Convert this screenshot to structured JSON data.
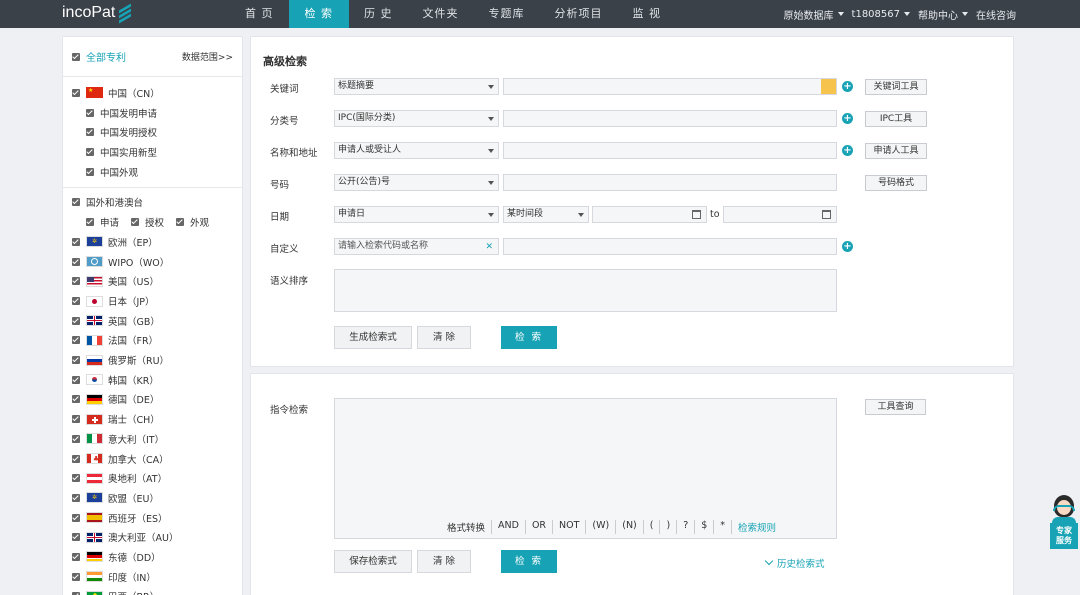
{
  "brand": {
    "logo_text": "incoPat"
  },
  "nav": {
    "items": [
      "首 页",
      "检 索",
      "历 史",
      "文件夹",
      "专题库",
      "分析项目",
      "监 视"
    ],
    "active_index": 1
  },
  "topright": {
    "database": "原始数据库",
    "user": "t1808567",
    "help": "帮助中心",
    "consult": "在线咨询"
  },
  "sidebar": {
    "all_label": "全部专利",
    "range_label": "数据范围>>",
    "cn_label": "中国（CN）",
    "cn_sub": [
      "中国发明申请",
      "中国发明授权",
      "中国实用新型",
      "中国外观"
    ],
    "foreign_label": "国外和港澳台",
    "foreign_types": [
      "申请",
      "授权",
      "外观"
    ],
    "countries": [
      {
        "label": "欧洲（EP）",
        "flag": "ep"
      },
      {
        "label": "WIPO（WO）",
        "flag": "wo"
      },
      {
        "label": "美国（US）",
        "flag": "us"
      },
      {
        "label": "日本（JP）",
        "flag": "jp"
      },
      {
        "label": "英国（GB）",
        "flag": "gb"
      },
      {
        "label": "法国（FR）",
        "flag": "fr"
      },
      {
        "label": "俄罗斯（RU）",
        "flag": "ru"
      },
      {
        "label": "韩国（KR）",
        "flag": "kr"
      },
      {
        "label": "德国（DE）",
        "flag": "de"
      },
      {
        "label": "瑞士（CH）",
        "flag": "ch"
      },
      {
        "label": "意大利（IT）",
        "flag": "it"
      },
      {
        "label": "加拿大（CA）",
        "flag": "ca"
      },
      {
        "label": "奥地利（AT）",
        "flag": "at"
      },
      {
        "label": "欧盟（EU）",
        "flag": "eu"
      },
      {
        "label": "西班牙（ES）",
        "flag": "es"
      },
      {
        "label": "澳大利亚（AU）",
        "flag": "au"
      },
      {
        "label": "东德（DD）",
        "flag": "dd"
      },
      {
        "label": "印度（IN）",
        "flag": "in"
      },
      {
        "label": "巴西（BR）",
        "flag": "br"
      }
    ]
  },
  "advanced": {
    "title": "高级检索",
    "keyword_label": "关键词",
    "keyword_select": "标题摘要",
    "keyword_tool": "关键词工具",
    "class_label": "分类号",
    "class_select": "IPC(国际分类)",
    "class_tool": "IPC工具",
    "name_label": "名称和地址",
    "name_select": "申请人或受让人",
    "name_tool": "申请人工具",
    "number_label": "号码",
    "number_select": "公开(公告)号",
    "number_tool": "号码格式",
    "date_label": "日期",
    "date_select": "申请日",
    "date_range_select": "某时间段",
    "date_to": "to",
    "custom_label": "自定义",
    "custom_placeholder": "请输入检索代码或名称",
    "semantic_label": "语义排序",
    "gen_button": "生成检索式",
    "clear_button": "清 除",
    "search_button": "检 索"
  },
  "command": {
    "label": "指令检索",
    "tool_button": "工具查询",
    "ops": [
      "格式转换",
      "AND",
      "OR",
      "NOT",
      "(W)",
      "(N)",
      "(",
      ")",
      "?",
      "$",
      "*",
      "检索规则"
    ],
    "save_button": "保存检索式",
    "clear_button": "清 除",
    "search_button": "检 索",
    "history_label": "历史检索式"
  },
  "expert": {
    "label_line1": "专家",
    "label_line2": "服务"
  },
  "colors": {
    "accent": "#17a3b5",
    "nav_bg": "#3a4149"
  }
}
